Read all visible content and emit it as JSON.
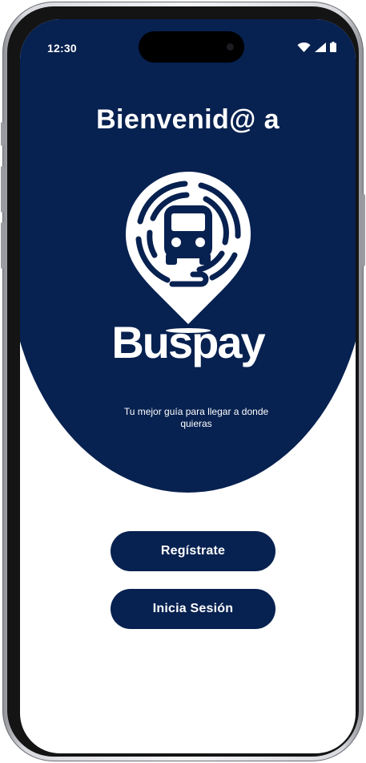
{
  "status_bar": {
    "time": "12:30",
    "icons": [
      "wifi-icon",
      "cellular-signal-icon",
      "battery-icon"
    ]
  },
  "welcome": {
    "title": "Bienvenid@ a",
    "brand_name": "Buspay",
    "logo_icon": "bus-location-pin-icon",
    "tagline": "Tu mejor guía para llegar a donde quieras"
  },
  "actions": {
    "register_label": "Regístrate",
    "login_label": "Inicia Sesión"
  },
  "colors": {
    "primary": "#072150",
    "background": "#ffffff",
    "on_primary": "#ffffff"
  }
}
